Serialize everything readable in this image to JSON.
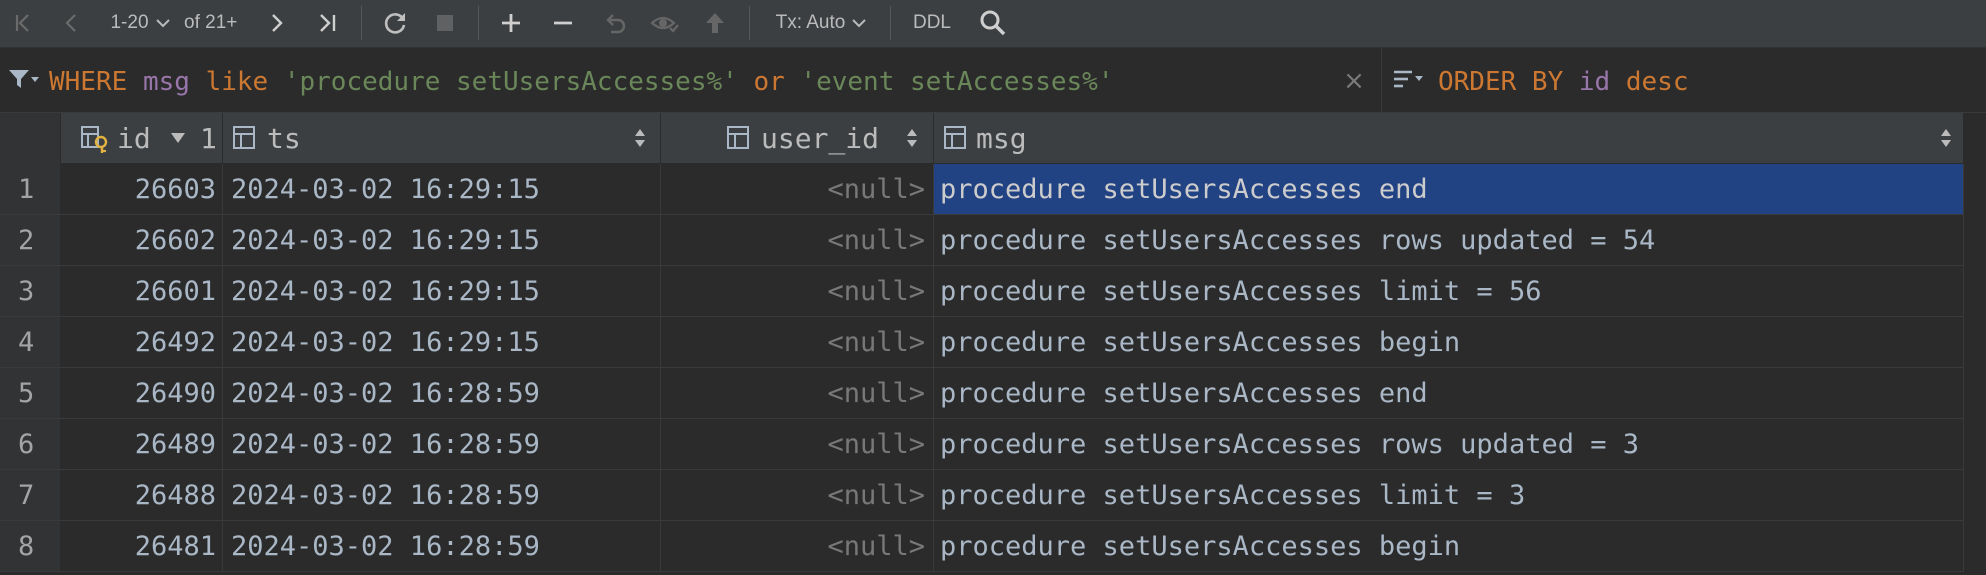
{
  "toolbar": {
    "page_range": "1-20",
    "of_total": "of 21+",
    "tx_mode": "Tx: Auto",
    "ddl_label": "DDL"
  },
  "filter": {
    "where_kw": "WHERE",
    "column": "msg",
    "like_kw": "like",
    "pattern1": "'procedure setUsersAccesses%'",
    "or_kw": "or",
    "pattern2": "'event setAccesses%'",
    "clear_symbol": "×"
  },
  "order": {
    "order_kw": "ORDER BY",
    "column": "id",
    "dir_kw": "desc"
  },
  "grid": {
    "columns": {
      "id": "id",
      "id_sort_order": "1",
      "ts": "ts",
      "user_id": "user_id",
      "msg": "msg"
    },
    "rows": [
      {
        "n": "1",
        "id": "26603",
        "ts": "2024-03-02 16:29:15",
        "user_id": "<null>",
        "msg": "procedure setUsersAccesses end"
      },
      {
        "n": "2",
        "id": "26602",
        "ts": "2024-03-02 16:29:15",
        "user_id": "<null>",
        "msg": "procedure setUsersAccesses rows updated = 54"
      },
      {
        "n": "3",
        "id": "26601",
        "ts": "2024-03-02 16:29:15",
        "user_id": "<null>",
        "msg": "procedure setUsersAccesses limit = 56"
      },
      {
        "n": "4",
        "id": "26492",
        "ts": "2024-03-02 16:29:15",
        "user_id": "<null>",
        "msg": "procedure setUsersAccesses begin"
      },
      {
        "n": "5",
        "id": "26490",
        "ts": "2024-03-02 16:28:59",
        "user_id": "<null>",
        "msg": "procedure setUsersAccesses end"
      },
      {
        "n": "6",
        "id": "26489",
        "ts": "2024-03-02 16:28:59",
        "user_id": "<null>",
        "msg": "procedure setUsersAccesses rows updated = 3"
      },
      {
        "n": "7",
        "id": "26488",
        "ts": "2024-03-02 16:28:59",
        "user_id": "<null>",
        "msg": "procedure setUsersAccesses limit = 3"
      },
      {
        "n": "8",
        "id": "26481",
        "ts": "2024-03-02 16:28:59",
        "user_id": "<null>",
        "msg": "procedure setUsersAccesses begin"
      }
    ]
  },
  "colors": {
    "keyword": "#cc7832",
    "column": "#9876aa",
    "string": "#6a8759",
    "selection": "#214283"
  }
}
